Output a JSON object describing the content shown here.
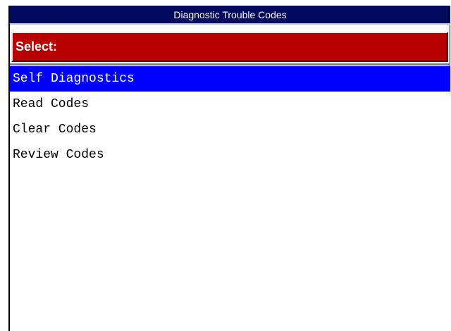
{
  "window": {
    "title": "Diagnostic Trouble Codes"
  },
  "prompt": {
    "label": "Select:"
  },
  "menu": {
    "selected_index": 0,
    "items": [
      {
        "label": "Self Diagnostics"
      },
      {
        "label": "Read Codes"
      },
      {
        "label": "Clear Codes"
      },
      {
        "label": "Review Codes"
      }
    ]
  },
  "colors": {
    "title_bar": "#000a5c",
    "select_bar": "#b80000",
    "selection_highlight": "#0000ff"
  }
}
